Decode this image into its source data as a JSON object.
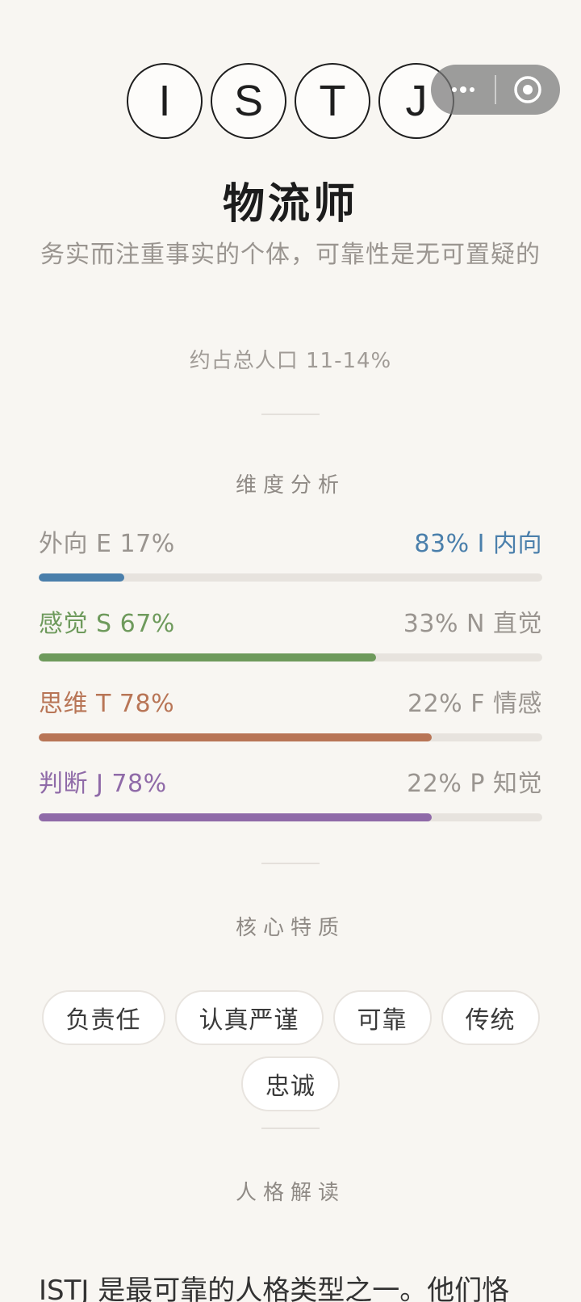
{
  "letters": [
    "I",
    "S",
    "T",
    "J"
  ],
  "type_name": "物流师",
  "description": "务实而注重事实的个体，可靠性是无可置疑的",
  "population": "约占总人口 11-14%",
  "sections": {
    "dimensions_title": "维度分析",
    "traits_title": "核心特质",
    "interpretation_title": "人格解读"
  },
  "dimensions": [
    {
      "left_label": "外向 E  17%",
      "right_label": "83%  I 内向",
      "dominant": "right",
      "left_percent": 17,
      "color": "#4a7fab"
    },
    {
      "left_label": "感觉 S  67%",
      "right_label": "33%  N 直觉",
      "dominant": "left",
      "left_percent": 67,
      "color": "#6e9a5c"
    },
    {
      "left_label": "思维 T  78%",
      "right_label": "22%  F 情感",
      "dominant": "left",
      "left_percent": 78,
      "color": "#b87556"
    },
    {
      "left_label": "判断 J  78%",
      "right_label": "22%  P 知觉",
      "dominant": "left",
      "left_percent": 78,
      "color": "#8f6aa8"
    }
  ],
  "traits": [
    "负责任",
    "认真严谨",
    "可靠",
    "传统",
    "忠诚"
  ],
  "interpretation_text": "ISTJ 是最可靠的人格类型之一。他们恪",
  "colors": {
    "muted_text": "#9a9590",
    "background": "#f8f6f2"
  }
}
